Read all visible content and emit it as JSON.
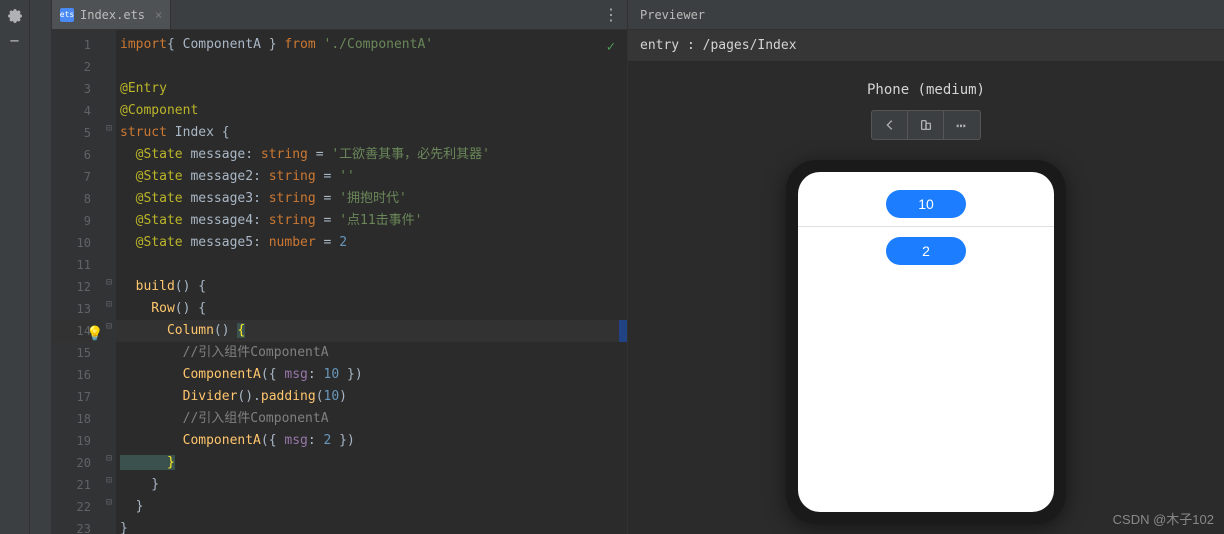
{
  "toolbar": {
    "gear": "⚙",
    "minus": "−"
  },
  "tab": {
    "filename": "Index.ets",
    "icon_text": "ets"
  },
  "gutter_lines": [
    "1",
    "2",
    "3",
    "4",
    "5",
    "6",
    "7",
    "8",
    "9",
    "10",
    "11",
    "12",
    "13",
    "14",
    "15",
    "16",
    "17",
    "18",
    "19",
    "20",
    "21",
    "22",
    "23"
  ],
  "code": {
    "l1_import": "import",
    "l1_brace_open": "{ ",
    "l1_comp": "ComponentA",
    "l1_brace_close": " }",
    "l1_from": " from ",
    "l1_path": "'./ComponentA'",
    "l3_entry": "@Entry",
    "l4_component": "@Component",
    "l5_struct": "struct",
    "l5_name": " Index ",
    "l5_brace": "{",
    "l6_state": "  @State",
    "l6_var": " message",
    "l6_colon": ": ",
    "l6_type": "string",
    "l6_eq": " = ",
    "l6_val": "'工欲善其事，必先利其器'",
    "l7_state": "  @State",
    "l7_var": " message2",
    "l7_colon": ": ",
    "l7_type": "string",
    "l7_eq": " = ",
    "l7_val": "''",
    "l8_state": "  @State",
    "l8_var": " message3",
    "l8_colon": ": ",
    "l8_type": "string",
    "l8_eq": " = ",
    "l8_val": "'拥抱时代'",
    "l9_state": "  @State",
    "l9_var": " message4",
    "l9_colon": ": ",
    "l9_type": "string",
    "l9_eq": " = ",
    "l9_val": "'点11击事件'",
    "l10_state": "  @State",
    "l10_var": " message5",
    "l10_colon": ": ",
    "l10_type": "number",
    "l10_eq": " = ",
    "l10_val": "2",
    "l12_build": "  build",
    "l12_paren": "() ",
    "l12_brace": "{",
    "l13_row": "    Row",
    "l13_paren": "() ",
    "l13_brace": "{",
    "l14_col": "      Column",
    "l14_paren": "() ",
    "l14_brace": "{",
    "l15_comment": "        //引入组件ComponentA",
    "l16_comp": "        ComponentA",
    "l16_args_open": "({ ",
    "l16_prop": "msg",
    "l16_colon": ": ",
    "l16_val": "10",
    "l16_args_close": " })",
    "l17_div": "        Divider",
    "l17_paren": "().",
    "l17_pad": "padding",
    "l17_arg_open": "(",
    "l17_val": "10",
    "l17_arg_close": ")",
    "l18_comment": "        //引入组件ComponentA",
    "l19_comp": "        ComponentA",
    "l19_args_open": "({ ",
    "l19_prop": "msg",
    "l19_colon": ": ",
    "l19_val": "2",
    "l19_args_close": " })",
    "l20_brace": "      }",
    "l21_brace": "    }",
    "l22_brace": "  }",
    "l23_brace": "}"
  },
  "previewer": {
    "title": "Previewer",
    "entry": "entry : /pages/Index",
    "device_label": "Phone (medium)",
    "btn1": "10",
    "btn2": "2"
  },
  "watermark": "CSDN @木子102"
}
